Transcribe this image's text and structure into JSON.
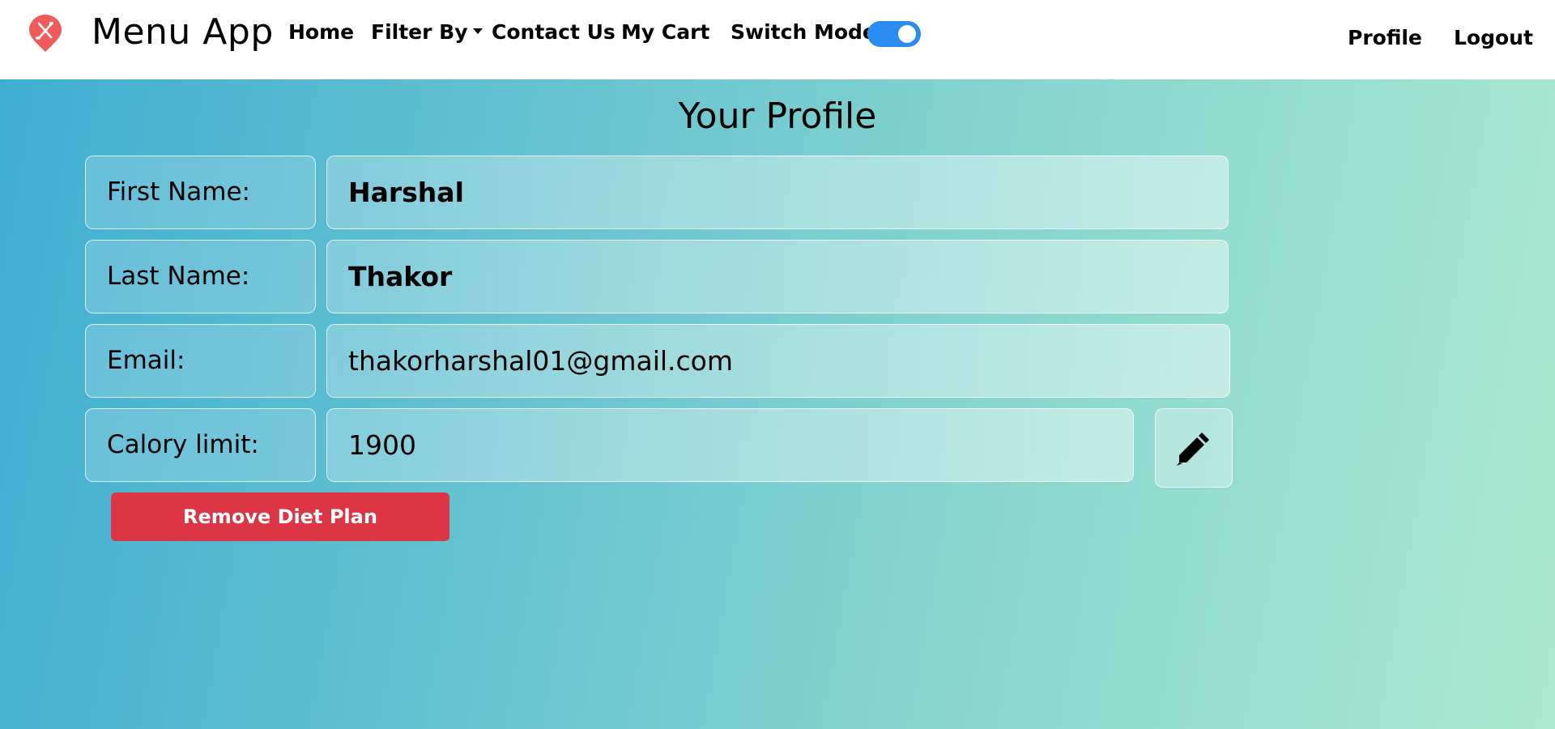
{
  "nav": {
    "brand": "Menu App",
    "links": [
      {
        "label": "Home"
      },
      {
        "label": "Filter By"
      },
      {
        "label": "Contact Us"
      },
      {
        "label": "My Cart"
      }
    ],
    "switch_label": "Switch Mode",
    "switch_on": true,
    "right_links": [
      {
        "label": "Profile"
      },
      {
        "label": "Logout"
      }
    ]
  },
  "profile": {
    "title": "Your Profile",
    "fields": [
      {
        "label": "First Name:",
        "value": "Harshal"
      },
      {
        "label": "Last Name:",
        "value": "Thakor"
      },
      {
        "label": "Email:",
        "value": "thakorharshal01@gmail.com"
      },
      {
        "label": "Calory limit:",
        "value": "1900"
      }
    ],
    "remove_button": "Remove Diet Plan"
  },
  "colors": {
    "logo": "#f05a5a",
    "toggle": "#2b8cf0",
    "danger": "#dc3545",
    "gradient_start": "#40aed2",
    "gradient_end": "#ace9d0"
  },
  "icons": {
    "logo": "restaurant-pin-icon",
    "edit": "pencil-icon",
    "dropdown": "caret-down-icon"
  }
}
